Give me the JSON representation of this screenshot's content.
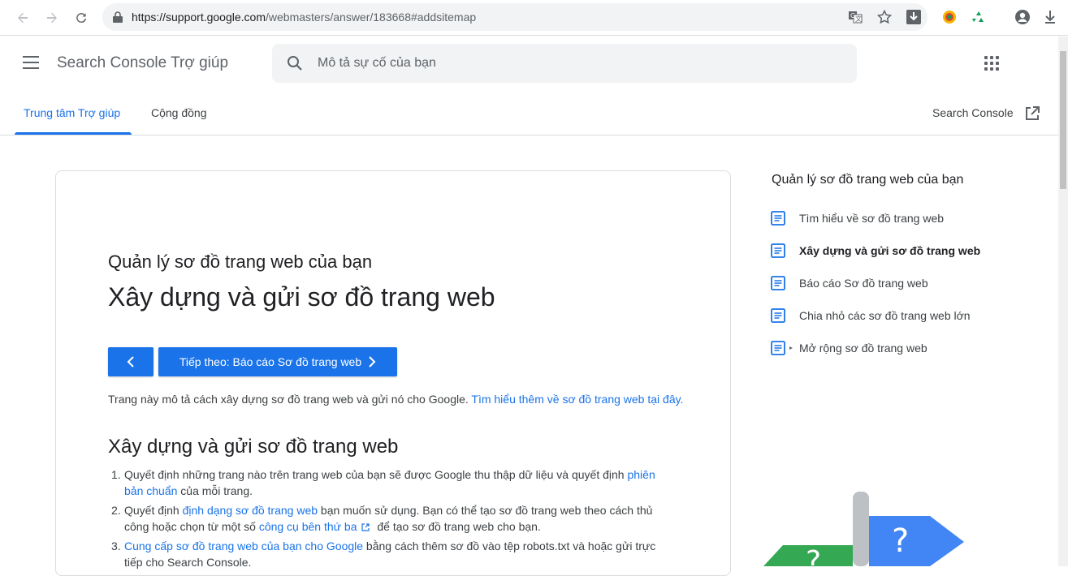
{
  "browser": {
    "url_host": "https://support.google.com",
    "url_path": "/webmasters/answer/183668#addsitemap"
  },
  "header": {
    "product_name": "Search Console Trợ giúp",
    "search_placeholder": "Mô tả sự cố của bạn",
    "tabs": [
      {
        "label": "Trung tâm Trợ giúp"
      },
      {
        "label": "Cộng đồng"
      }
    ],
    "external_link_label": "Search Console"
  },
  "article": {
    "parent_title": "Quản lý sơ đồ trang web của bạn",
    "title": "Xây dựng và gửi sơ đồ trang web",
    "next_button_label": "Tiếp theo: Báo cáo Sơ đồ trang web",
    "intro_text": "Trang này mô tả cách xây dựng sơ đồ trang web và gửi nó cho Google.",
    "intro_link": "Tìm hiểu thêm về sơ đồ trang web tại đây.",
    "section_title": "Xây dựng và gửi sơ đồ trang web",
    "steps": [
      {
        "num": "1.",
        "text_a": "Quyết định những trang nào trên trang web của bạn sẽ được Google thu thập dữ liệu và quyết định ",
        "link_a": "phiên bản chuẩn",
        "text_b": " của mỗi trang."
      },
      {
        "num": "2.",
        "text_a": "Quyết định ",
        "link_a": "định dạng sơ đồ trang web",
        "text_b": " bạn muốn sử dụng. Bạn có thể tạo sơ đồ trang web theo cách thủ công hoặc chọn từ một số ",
        "link_b": "công cụ bên thứ ba",
        "text_c": " để tạo sơ đồ trang web cho bạn."
      },
      {
        "num": "3.",
        "link_a": "Cung cấp sơ đồ trang web của bạn cho Google",
        "text_a": " bằng cách thêm sơ đồ vào tệp robots.txt và hoặc gửi trực tiếp cho Search Console."
      }
    ]
  },
  "sidebar": {
    "title": "Quản lý sơ đồ trang web của bạn",
    "items": [
      {
        "label": "Tìm hiểu về sơ đồ trang web"
      },
      {
        "label": "Xây dựng và gửi sơ đồ trang web"
      },
      {
        "label": "Báo cáo Sơ đồ trang web"
      },
      {
        "label": "Chia nhỏ các sơ đồ trang web lớn"
      },
      {
        "label": "Mở rộng sơ đồ trang web"
      }
    ]
  },
  "colors": {
    "accent": "#1a73e8",
    "text": "#202124",
    "muted": "#5f6368"
  }
}
